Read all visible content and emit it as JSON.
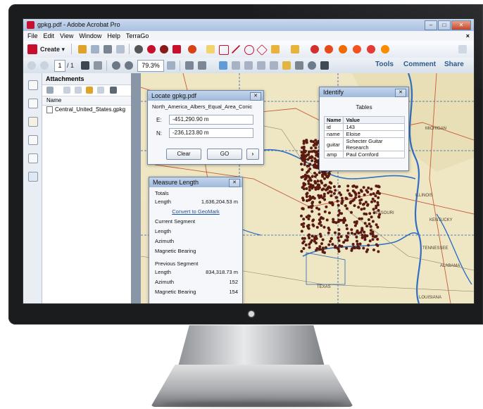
{
  "window": {
    "title": "gpkg.pdf - Adobe Acrobat Pro",
    "controls": [
      "–",
      "□",
      "✕"
    ]
  },
  "menu": {
    "items": [
      "File",
      "Edit",
      "View",
      "Window",
      "Help",
      "TerraGo"
    ],
    "close": "×"
  },
  "toolbar": {
    "create_label": "Create ▾"
  },
  "nav": {
    "page_current": "1",
    "page_total": "/ 1",
    "zoom": "79.3%",
    "tools": "Tools",
    "comment": "Comment",
    "share": "Share"
  },
  "attachments": {
    "title": "Attachments",
    "column": "Name",
    "files": [
      "Central_United_States.gpkg"
    ]
  },
  "locate": {
    "title": "Locate gpkg.pdf",
    "projection": "North_America_Albers_Equal_Area_Conic",
    "e_label": "E:",
    "e_value": "-451,290.90 m",
    "n_label": "N:",
    "n_value": "-236,123.80 m",
    "clear": "Clear",
    "go": "GO",
    "next": "›"
  },
  "identify": {
    "title": "Identify",
    "subtitle": "Tables",
    "headers": [
      "Name",
      "Value"
    ],
    "rows": [
      [
        "id",
        "143"
      ],
      [
        "name",
        "Eloise"
      ],
      [
        "guitar",
        "Schecter Guitar Research"
      ],
      [
        "amp",
        "Paul Cornford"
      ]
    ]
  },
  "measure": {
    "title": "Measure Length",
    "totals": "Totals",
    "length_label": "Length",
    "length_value": "1,636,204.53 m",
    "convert": "Convert to GeoMark",
    "current": "Current Segment",
    "cur_length": "Length",
    "cur_azimuth": "Azimuth",
    "cur_bearing": "Magnetic Bearing",
    "previous": "Previous Segment",
    "prev_length": "Length",
    "prev_length_value": "834,318.73 m",
    "prev_azimuth": "Azimuth",
    "prev_azimuth_value": "152",
    "prev_bearing": "Magnetic Bearing",
    "prev_bearing_value": "154"
  },
  "map_labels": {
    "michigan": "MICHIGAN",
    "illinois": "ILLINOIS",
    "kentucky": "KENTUCKY",
    "tennessee": "TENNESSEE",
    "alabama": "ALABAMA",
    "texas": "TEXAS",
    "louisiana": "LOUISIANA",
    "missouri": "MISSOURI"
  },
  "colors": {
    "point": "#5a1a12",
    "river": "#2f6fc4",
    "border": "#2a5fb0",
    "accent": "#c8102e"
  }
}
